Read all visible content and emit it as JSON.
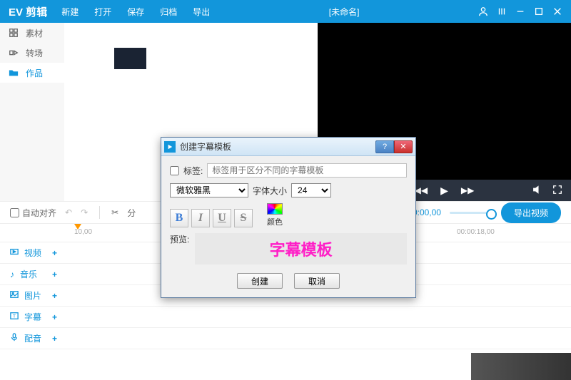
{
  "app": {
    "title": "EV 剪辑",
    "doc_name": "[未命名]"
  },
  "menu": [
    "新建",
    "打开",
    "保存",
    "归档",
    "导出"
  ],
  "sidebar": {
    "items": [
      {
        "label": "素材",
        "icon": "grid-icon"
      },
      {
        "label": "转场",
        "icon": "transition-icon"
      },
      {
        "label": "作品",
        "icon": "folder-icon",
        "active": true
      }
    ]
  },
  "toolbar": {
    "auto_align": "自动对齐",
    "time_display": "00:00,00",
    "export_label": "导出视频"
  },
  "ruler": {
    "l0": "10,00",
    "l1": "00:00:18,00"
  },
  "tracks": [
    {
      "label": "视频",
      "icon": "video-icon"
    },
    {
      "label": "音乐",
      "icon": "music-icon"
    },
    {
      "label": "图片",
      "icon": "image-icon"
    },
    {
      "label": "字幕",
      "icon": "text-icon"
    },
    {
      "label": "配音",
      "icon": "mic-icon"
    }
  ],
  "dialog": {
    "title": "创建字幕模板",
    "tag_label": "标签:",
    "tag_placeholder": "标签用于区分不同的字幕模板",
    "font_name": "微软雅黑",
    "size_label": "字体大小",
    "size_value": "24",
    "style_b": "B",
    "style_i": "I",
    "style_u": "U",
    "style_s": "S",
    "color_label": "颜色",
    "preview_label": "预览:",
    "preview_text": "字幕模板",
    "create_btn": "创建",
    "cancel_btn": "取消"
  }
}
